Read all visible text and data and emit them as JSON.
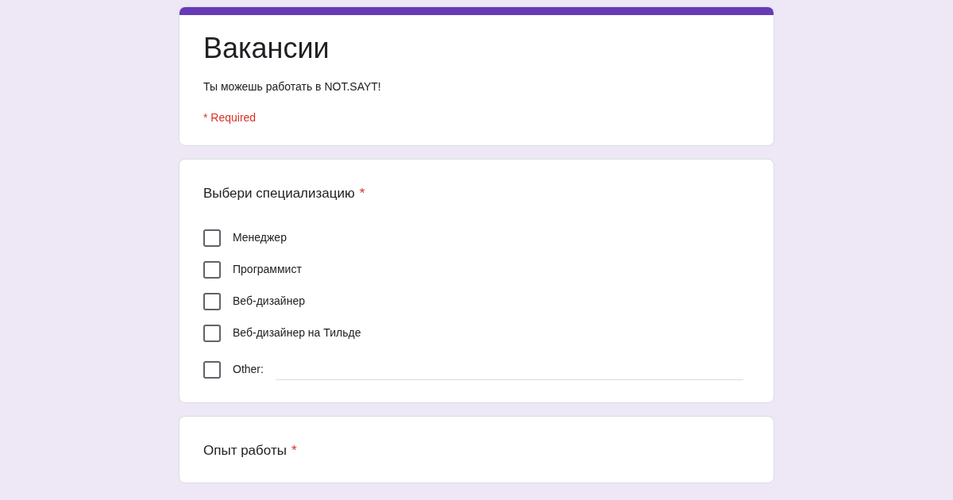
{
  "form": {
    "title": "Вакансии",
    "description": "Ты можешь работать в NOT.SAYT!",
    "required_note": "* Required"
  },
  "questions": [
    {
      "title": "Выбери специализацию",
      "required_mark": "*",
      "options": [
        {
          "kind": "checkbox",
          "label": "Менеджер",
          "checked": false
        },
        {
          "kind": "checkbox",
          "label": "Программист",
          "checked": false
        },
        {
          "kind": "checkbox",
          "label": "Веб-дизайнер",
          "checked": false
        },
        {
          "kind": "checkbox",
          "label": "Веб-дизайнер на Тильде",
          "checked": false
        },
        {
          "kind": "other",
          "label": "Other:",
          "checked": false
        }
      ]
    },
    {
      "title": "Опыт работы",
      "required_mark": "*"
    }
  ]
}
